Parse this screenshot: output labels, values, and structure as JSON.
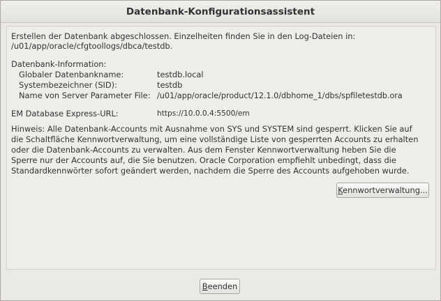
{
  "window": {
    "title": "Datenbank-Konfigurationsassistent"
  },
  "summary": {
    "line1": "Erstellen der Datenbank abgeschlossen. Einzelheiten finden Sie in den Log-Dateien in:",
    "log_path": " /u01/app/oracle/cfgtoollogs/dbca/testdb."
  },
  "db_info": {
    "header": "Datenbank-Information:",
    "rows": [
      {
        "label": "Globaler Datenbankname:",
        "value": "testdb.local"
      },
      {
        "label": "Systembezeichner (SID):",
        "value": "testdb"
      },
      {
        "label": "Name von Server Parameter File:",
        "value": "/u01/app/oracle/product/12.1.0/dbhome_1/dbs/spfiletestdb.ora"
      }
    ]
  },
  "em": {
    "label": "EM Database Express-URL:",
    "value": "https://10.0.0.4:5500/em"
  },
  "hint": {
    "lines": [
      "Hinweis: Alle Datenbank-Accounts mit Ausnahme von SYS und SYSTEM sind gesperrt. Klicken Sie auf",
      "die Schaltfläche Kennwortverwaltung, um eine vollständige Liste von gesperrten Accounts zu erhalten",
      "oder die Datenbank-Accounts zu verwalten. Aus dem Fenster Kennwortverwaltung heben Sie die",
      "Sperre nur der Accounts auf, die Sie benutzen. Oracle Corporation empfiehlt unbedingt, dass die",
      "Standardkennwörter sofort geändert werden, nachdem die Sperre des Accounts aufgehoben wurde."
    ]
  },
  "buttons": {
    "password_mgmt": "Kennwortverwaltung...",
    "password_mgmt_mnemonic": "K",
    "password_mgmt_rest": "ennwortverwaltung...",
    "finish": "Beenden",
    "finish_mnemonic": "B",
    "finish_rest": "eenden"
  }
}
